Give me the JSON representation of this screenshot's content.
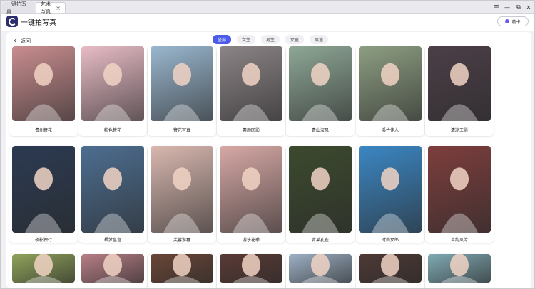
{
  "tabs": [
    {
      "label": "一键拍写真"
    },
    {
      "label": "艺术写真",
      "close": "×"
    }
  ],
  "window_controls": {
    "menu": "☰",
    "minimize": "—",
    "restore": "⧉",
    "close": "✕"
  },
  "header": {
    "app_title": "一键拍写真",
    "action_label": "前卡",
    "action_icon": "coin-icon"
  },
  "nav": {
    "back_label": "返回",
    "back_icon": "‹"
  },
  "filters": [
    {
      "label": "全部",
      "active": true
    },
    {
      "label": "女生",
      "active": false
    },
    {
      "label": "男生",
      "active": false
    },
    {
      "label": "女童",
      "active": false
    },
    {
      "label": "男童",
      "active": false
    }
  ],
  "rows": [
    {
      "items": [
        {
          "label": "贵州簪花",
          "color": "#c98d8f"
        },
        {
          "label": "粉色簪花",
          "color": "#e8bcc6"
        },
        {
          "label": "簪花写真",
          "color": "#9ab7cf"
        },
        {
          "label": "素颜回影",
          "color": "#8c8486"
        },
        {
          "label": "青山汉风",
          "color": "#8ea796"
        },
        {
          "label": "溪竹佳人",
          "color": "#8d9e82"
        },
        {
          "label": "清凉王影",
          "color": "#4c3f48"
        }
      ]
    },
    {
      "items": [
        {
          "label": "夜影独行",
          "color": "#2b3a52"
        },
        {
          "label": "梧梦皇宫",
          "color": "#4d6e91"
        },
        {
          "label": "芙蓉游春",
          "color": "#d9b8b0"
        },
        {
          "label": "游乐花季",
          "color": "#d7a9a6"
        },
        {
          "label": "青某孔雀",
          "color": "#3c4a2e"
        },
        {
          "label": "时尚女郎",
          "color": "#3b87c4"
        },
        {
          "label": "苗韵风芳",
          "color": "#7d3e3d"
        }
      ]
    },
    {
      "items": [
        {
          "label": "",
          "color": "#8fa35a"
        },
        {
          "label": "",
          "color": "#b77e86"
        },
        {
          "label": "",
          "color": "#6a4637"
        },
        {
          "label": "",
          "color": "#5a3a35"
        },
        {
          "label": "",
          "color": "#9db0c4"
        },
        {
          "label": "",
          "color": "#4d3935"
        },
        {
          "label": "",
          "color": "#7fa9b3"
        }
      ]
    }
  ]
}
